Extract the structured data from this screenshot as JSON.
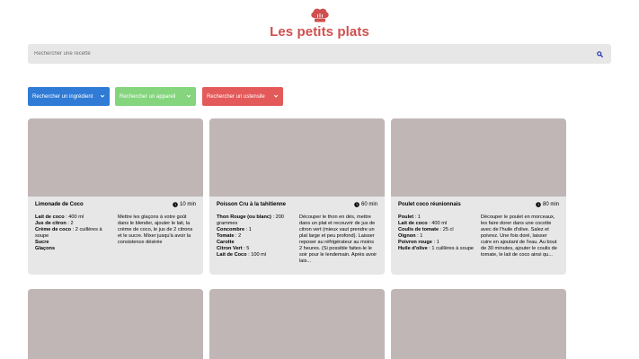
{
  "header": {
    "title": "Les petits plats",
    "logo_icon": "chef-hat-icon"
  },
  "search": {
    "placeholder": "Rechercher une recette",
    "icon": "search-icon"
  },
  "filters": [
    {
      "label": "Rechercher un ingrédient",
      "color": "#2f7bd6"
    },
    {
      "label": "Rechercher un appareil",
      "color": "#84d57d"
    },
    {
      "label": "Rechercher un ustensile",
      "color": "#e45a5a"
    }
  ],
  "recipes": [
    {
      "name": "Limonade de Coco",
      "time": "10 min",
      "ingredients": [
        {
          "name": "Lait de coco",
          "qty": ": 400 ml"
        },
        {
          "name": "Jus de citron",
          "qty": ": 2"
        },
        {
          "name": "Crème de coco",
          "qty": ": 2 cuillères à soupe"
        },
        {
          "name": "Sucre",
          "qty": ""
        },
        {
          "name": "Glaçons",
          "qty": ""
        }
      ],
      "description": "Mettre les glaçons à votre goût dans le blender, ajouter le lait, la crème de coco, le jus de 2 citrons et le sucre. Mixer jusqu'à avoir la consistence désirée"
    },
    {
      "name": "Poisson Cru à la tahitienne",
      "time": "60 min",
      "ingredients": [
        {
          "name": "Thon Rouge (ou blanc)",
          "qty": ": 200 grammes"
        },
        {
          "name": "Concombre",
          "qty": ": 1"
        },
        {
          "name": "Tomate",
          "qty": ": 2"
        },
        {
          "name": "Carotte",
          "qty": ""
        },
        {
          "name": "Citron Vert",
          "qty": ": 5"
        },
        {
          "name": "Lait de Coco",
          "qty": ": 100 ml"
        }
      ],
      "description": "Découper le thon en dés, mettre dans un plat et recouvrir de jus de citron vert (mieux vaut prendre un plat large et peu profond). Laisser reposer au réfrigérateur au moins 2 heures. (Si possible faites-le le soir pour le lendemain. Après avoir lais..."
    },
    {
      "name": "Poulet coco réunionnais",
      "time": "80 min",
      "ingredients": [
        {
          "name": "Poulet",
          "qty": ": 1"
        },
        {
          "name": "Lait de coco",
          "qty": ": 400 ml"
        },
        {
          "name": "Coulis de tomate",
          "qty": ": 25 cl"
        },
        {
          "name": "Oignon",
          "qty": ": 1"
        },
        {
          "name": "Poivron rouge",
          "qty": ": 1"
        },
        {
          "name": "Huile d'olive",
          "qty": ": 1 cuillères à soupe"
        }
      ],
      "description": "Découper le poulet en morceaux, les faire dorer dans une cocotte avec de l'huile d'olive. Salez et poivrez. Une fois doré, laisser cuire en ajoutant de l'eau. Au bout de 30 minutes, ajouter le coulis de tomate, le lait de coco ainsi qu..."
    }
  ],
  "colors": {
    "brand": "#d04f4f",
    "card_bg": "#e7e7e7",
    "thumb_bg": "#c1b6b6",
    "search_icon": "#1a2ea8"
  }
}
